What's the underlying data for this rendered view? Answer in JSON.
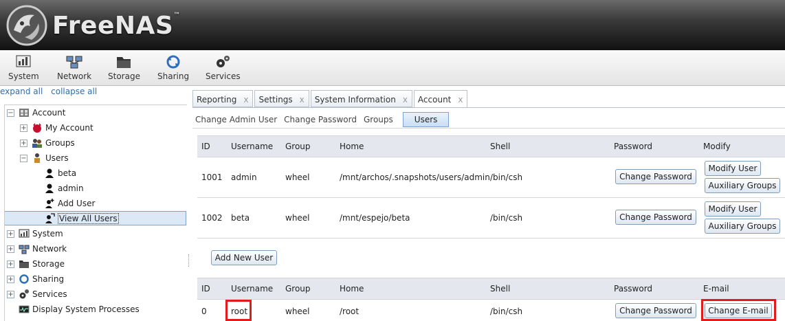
{
  "app": {
    "name": "FreeNAS",
    "tm": "™"
  },
  "toolbar": [
    {
      "label": "System",
      "icon": "system-monitor-icon"
    },
    {
      "label": "Network",
      "icon": "network-icon"
    },
    {
      "label": "Storage",
      "icon": "storage-icon"
    },
    {
      "label": "Sharing",
      "icon": "sharing-icon"
    },
    {
      "label": "Services",
      "icon": "services-gears-icon"
    }
  ],
  "tree_links": {
    "expand": "expand all",
    "collapse": "collapse all"
  },
  "tree": {
    "account": "Account",
    "my_account": "My Account",
    "groups": "Groups",
    "users": "Users",
    "beta": "beta",
    "admin": "admin",
    "add_user": "Add User",
    "view_all_users": "View All Users",
    "system": "System",
    "network": "Network",
    "storage": "Storage",
    "sharing": "Sharing",
    "services": "Services",
    "display_processes": "Display System Processes",
    "expand_symbol": "+",
    "collapse_symbol": "−"
  },
  "tabs": [
    {
      "label": "Reporting",
      "close": "x"
    },
    {
      "label": "Settings",
      "close": "x"
    },
    {
      "label": "System Information",
      "close": "x"
    },
    {
      "label": "Account",
      "close": "x"
    }
  ],
  "subnav": {
    "change_admin_user": "Change Admin User",
    "change_password": "Change Password",
    "groups": "Groups",
    "users": "Users"
  },
  "users_table": {
    "headers": {
      "id": "ID",
      "username": "Username",
      "group": "Group",
      "home": "Home",
      "shell": "Shell",
      "password": "Password",
      "modify": "Modify"
    },
    "rows": [
      {
        "id": "1001",
        "username": "admin",
        "group": "wheel",
        "home": "/mnt/archos/.snapshots/users/admin",
        "shell": "/bin/csh",
        "password_btn": "Change Password",
        "modify_btn": "Modify User",
        "aux_btn": "Auxiliary Groups"
      },
      {
        "id": "1002",
        "username": "beta",
        "group": "wheel",
        "home": "/mnt/espejo/beta",
        "shell": "/bin/csh",
        "password_btn": "Change Password",
        "modify_btn": "Modify User",
        "aux_btn": "Auxiliary Groups"
      }
    ],
    "add_new_user": "Add New User"
  },
  "root_table": {
    "headers": {
      "id": "ID",
      "username": "Username",
      "group": "Group",
      "home": "Home",
      "shell": "Shell",
      "password": "Password",
      "email": "E-mail"
    },
    "row": {
      "id": "0",
      "username": "root",
      "group": "wheel",
      "home": "/root",
      "shell": "/bin/csh",
      "password_btn": "Change Password",
      "email_btn": "Change E-mail"
    }
  },
  "colors": {
    "highlight": "#e31b1b",
    "link": "#2a6fb3",
    "selected": "#dbe8f6"
  }
}
